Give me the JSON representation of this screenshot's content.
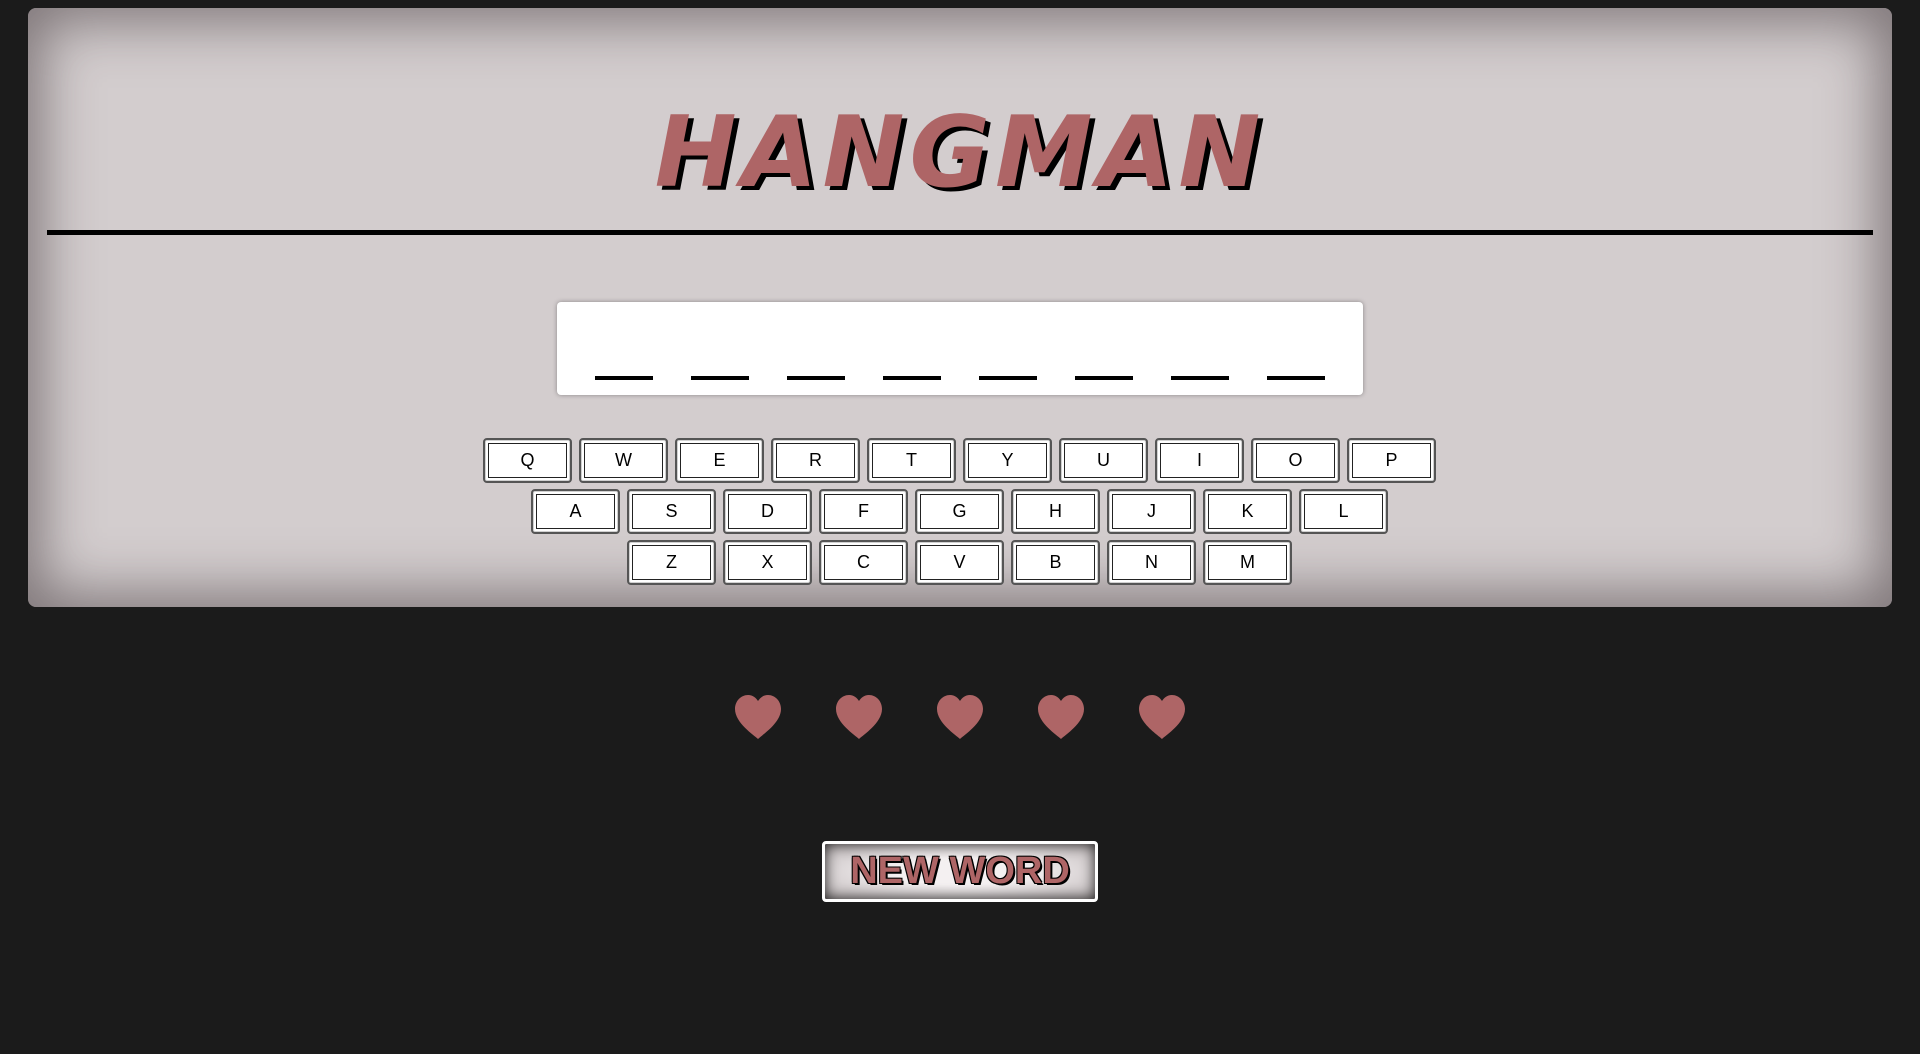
{
  "game": {
    "title": "HANGMAN",
    "word_length": 8,
    "revealed_letters": [
      "",
      "",
      "",
      "",
      "",
      "",
      "",
      ""
    ]
  },
  "keyboard": {
    "rows": [
      [
        "Q",
        "W",
        "E",
        "R",
        "T",
        "Y",
        "U",
        "I",
        "O",
        "P"
      ],
      [
        "A",
        "S",
        "D",
        "F",
        "G",
        "H",
        "J",
        "K",
        "L"
      ],
      [
        "Z",
        "X",
        "C",
        "V",
        "B",
        "N",
        "M"
      ]
    ]
  },
  "lives": {
    "remaining": 5,
    "total": 5,
    "icon": "heart-icon"
  },
  "controls": {
    "new_word_label": "NEW WORD"
  },
  "colors": {
    "accent": "#ae6566",
    "background": "#1b1b1b",
    "board": "#d3cdce"
  }
}
